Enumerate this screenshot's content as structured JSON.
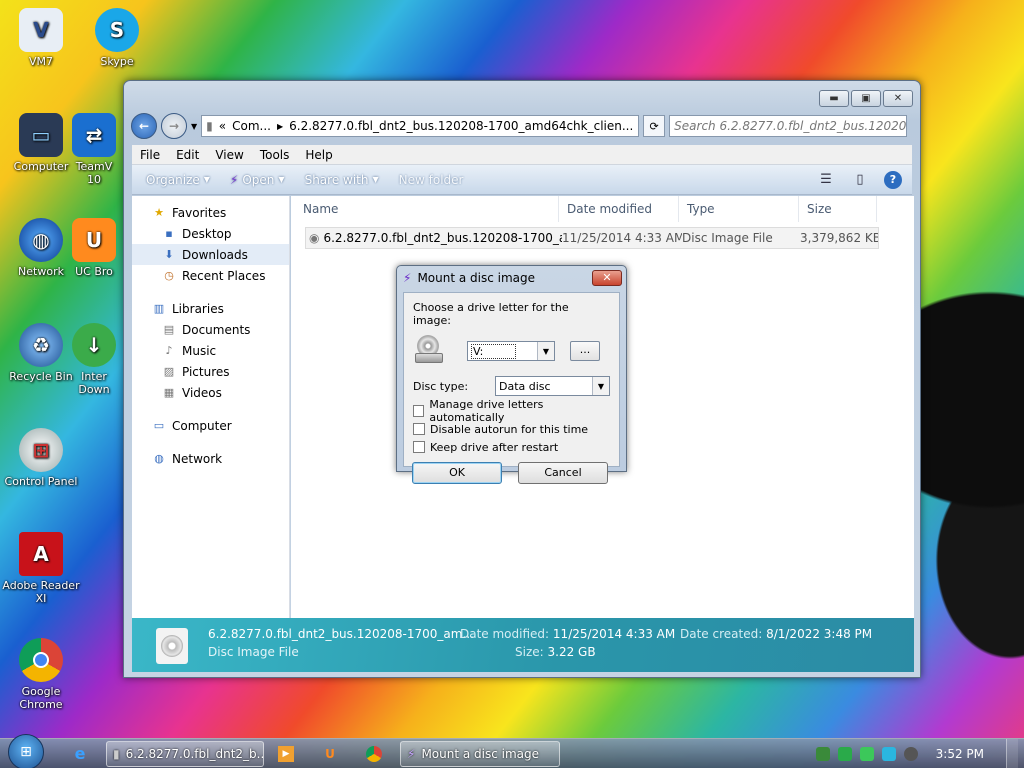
{
  "desktop": {
    "icons": [
      {
        "label": "VM7"
      },
      {
        "label": "Skype"
      },
      {
        "label": "Computer"
      },
      {
        "label": "TeamV\n10"
      },
      {
        "label": "Network"
      },
      {
        "label": "UC Bro"
      },
      {
        "label": "Recycle Bin"
      },
      {
        "label": "Inter\nDown"
      },
      {
        "label": "Control Panel"
      },
      {
        "label": "Adobe Reader\nXI"
      },
      {
        "label": "Google\nChrome"
      }
    ]
  },
  "explorer": {
    "address_prefix": "«",
    "address_crumb1": "Com...",
    "address_crumb2": "6.2.8277.0.fbl_dnt2_bus.120208-1700_amd64chk_clien...",
    "search_placeholder": "Search 6.2.8277.0.fbl_dnt2_bus.120208...",
    "menu": [
      "File",
      "Edit",
      "View",
      "Tools",
      "Help"
    ],
    "toolbar": {
      "organize": "Organize",
      "open": "Open",
      "share": "Share with",
      "new_folder": "New folder"
    },
    "nav": {
      "favorites": "Favorites",
      "desktop": "Desktop",
      "downloads": "Downloads",
      "recent": "Recent Places",
      "libraries": "Libraries",
      "documents": "Documents",
      "music": "Music",
      "pictures": "Pictures",
      "videos": "Videos",
      "computer": "Computer",
      "network": "Network"
    },
    "columns": {
      "name": "Name",
      "date": "Date modified",
      "type": "Type",
      "size": "Size"
    },
    "files": [
      {
        "name": "6.2.8277.0.fbl_dnt2_bus.120208-1700_am...",
        "date": "11/25/2014 4:33 AM",
        "type": "Disc Image File",
        "size": "3,379,862 KB"
      }
    ],
    "details": {
      "name": "6.2.8277.0.fbl_dnt2_bus.120208-1700_am...",
      "type": "Disc Image File",
      "modified_label": "Date modified:",
      "modified": "11/25/2014 4:33 AM",
      "created_label": "Date created:",
      "created": "8/1/2022 3:48 PM",
      "size_label": "Size:",
      "size": "3.22 GB"
    }
  },
  "dialog": {
    "title": "Mount a disc image",
    "prompt": "Choose a drive letter for the image:",
    "drive_value": "V:",
    "browse_label": "...",
    "disc_type_label": "Disc type:",
    "disc_type_value": "Data disc",
    "opt_manage": "Manage drive letters automatically",
    "opt_autorun": "Disable autorun for this time",
    "opt_keep": "Keep drive after restart",
    "ok": "OK",
    "cancel": "Cancel"
  },
  "taskbar": {
    "task_explorer": "6.2.8277.0.fbl_dnt2_b...",
    "task_dialog": "Mount a disc image",
    "clock": "3:52 PM"
  }
}
